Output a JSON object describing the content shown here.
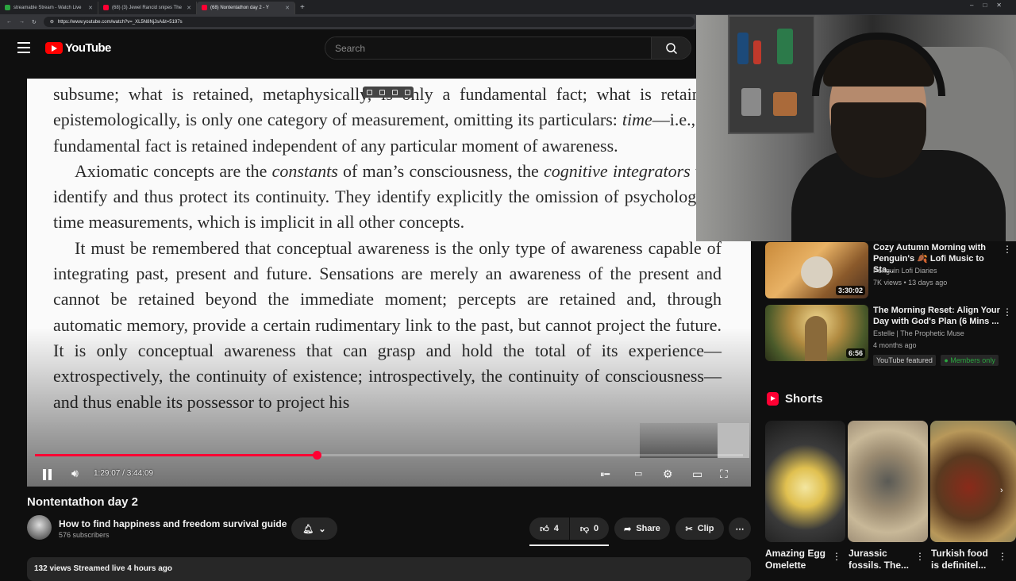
{
  "browser": {
    "tabs": [
      {
        "label": "streamable Stream - Watch Live",
        "color": "#2ba640"
      },
      {
        "label": "(68) (3) Jewel Rancid snipes The",
        "color": "#ff0033"
      },
      {
        "label": "(68) Nontentathon day 2 - Y",
        "color": "#ff0033"
      }
    ],
    "url": "https://www.youtube.com/watch?v=_XL5N8NjJsA&t=5197s"
  },
  "header": {
    "logo_text": "YouTube",
    "search_placeholder": "Search"
  },
  "video": {
    "paragraphs": [
      {
        "indent": false,
        "html": "subsume; what is retained, metaphysically, is only a fundamental fact; what is retained, epistemologically, is only one category of measurement, omitting its particulars: <i>time</i>—i.e., the fundamental fact is retained independent of any particular moment of awareness."
      },
      {
        "indent": true,
        "html": "Axiomatic concepts are the <i>constants</i> of man’s consciousness, the <i>cognitive integrators</i> that identify and thus protect its continuity. They identify explicitly the omission of psychological time measurements, which is implicit in all other concepts."
      },
      {
        "indent": true,
        "html": "It must be remembered that conceptual awareness is the only type of awareness capable of integrating past, present and future. Sensations are merely an awareness of the present and cannot be retained beyond the immediate moment; percepts are retained and, through automatic memory, provide a certain rudimentary link to the past, but cannot project the future. It is only conceptual awareness that can grasp and hold the total of its experience—extrospectively, the continuity of existence; introspectively, the continuity of consciousness—and thus enable its possessor to project his"
      }
    ],
    "time_display": "1:29:07 / 3:44:09",
    "progress_fraction": 0.398
  },
  "info": {
    "title": "Nontentathon day 2",
    "channel": "How to find happiness and freedom survival guide",
    "subscribers": "576 subscribers",
    "likes": "4",
    "dislikes": "0",
    "share_label": "Share",
    "clip_label": "Clip",
    "description_preview": "132 views  Streamed live 4 hours ago"
  },
  "recommendations": [
    {
      "title": "Cozy Autumn Morning with Penguin's 🍂 Lofi Music to Sta...",
      "channel": "Penguin Lofi Diaries",
      "meta": "7K views • 13 days ago",
      "duration": "3:30:02"
    },
    {
      "title": "The Morning Reset: Align Your Day with God's Plan (6 Mins ...",
      "channel": "Estelle | The Prophetic Muse",
      "meta": "4 months ago",
      "duration": "6:56",
      "badges": [
        "YouTube featured",
        "Members only"
      ]
    }
  ],
  "shorts": {
    "heading": "Shorts",
    "items": [
      {
        "title": "Amazing Egg Omelette"
      },
      {
        "title": "Jurassic fossils. The..."
      },
      {
        "title": "Turkish food is definitel..."
      }
    ]
  }
}
